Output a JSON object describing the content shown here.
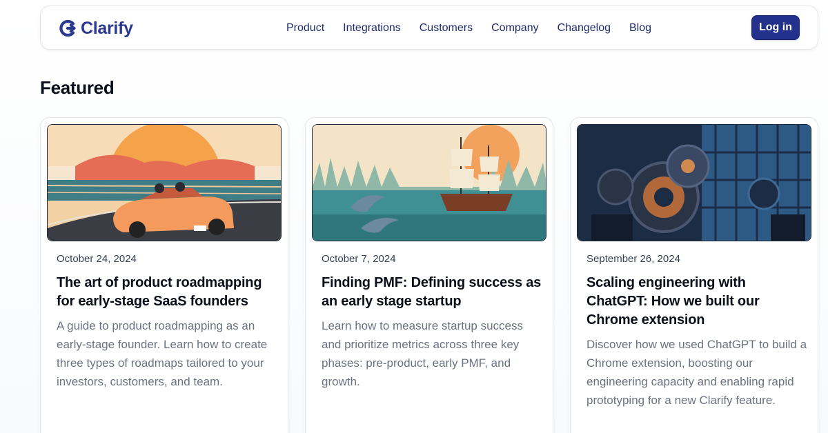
{
  "brand": {
    "name": "Clarify"
  },
  "nav": {
    "links": [
      "Product",
      "Integrations",
      "Customers",
      "Company",
      "Changelog",
      "Blog"
    ],
    "login_label": "Log in"
  },
  "colors": {
    "brand": "#23318c",
    "text": "#0f172a",
    "muted": "#6b7280"
  },
  "section": {
    "title": "Featured"
  },
  "cards": [
    {
      "date": "October 24, 2024",
      "title": "The art of product roadmapping for early-stage SaaS founders",
      "description": "A guide to product roadmapping as an early-stage founder. Learn how to create three types of roadmaps tailored to your investors, customers, and team.",
      "image": "convertible-car-sunset-illustration"
    },
    {
      "date": "October 7, 2024",
      "title": "Finding PMF: Defining success as an early stage startup",
      "description": "Learn how to measure startup success and prioritize metrics across three key phases: pre-product, early PMF, and growth.",
      "image": "sailing-ship-dolphins-illustration"
    },
    {
      "date": "September 26, 2024",
      "title": "Scaling engineering with ChatGPT: How we built our Chrome extension",
      "description": "Discover how we used ChatGPT to build a Chrome extension, boosting our engineering capacity and enabling rapid prototyping for a new Clarify feature.",
      "image": "gear-machinery-illustration"
    }
  ]
}
